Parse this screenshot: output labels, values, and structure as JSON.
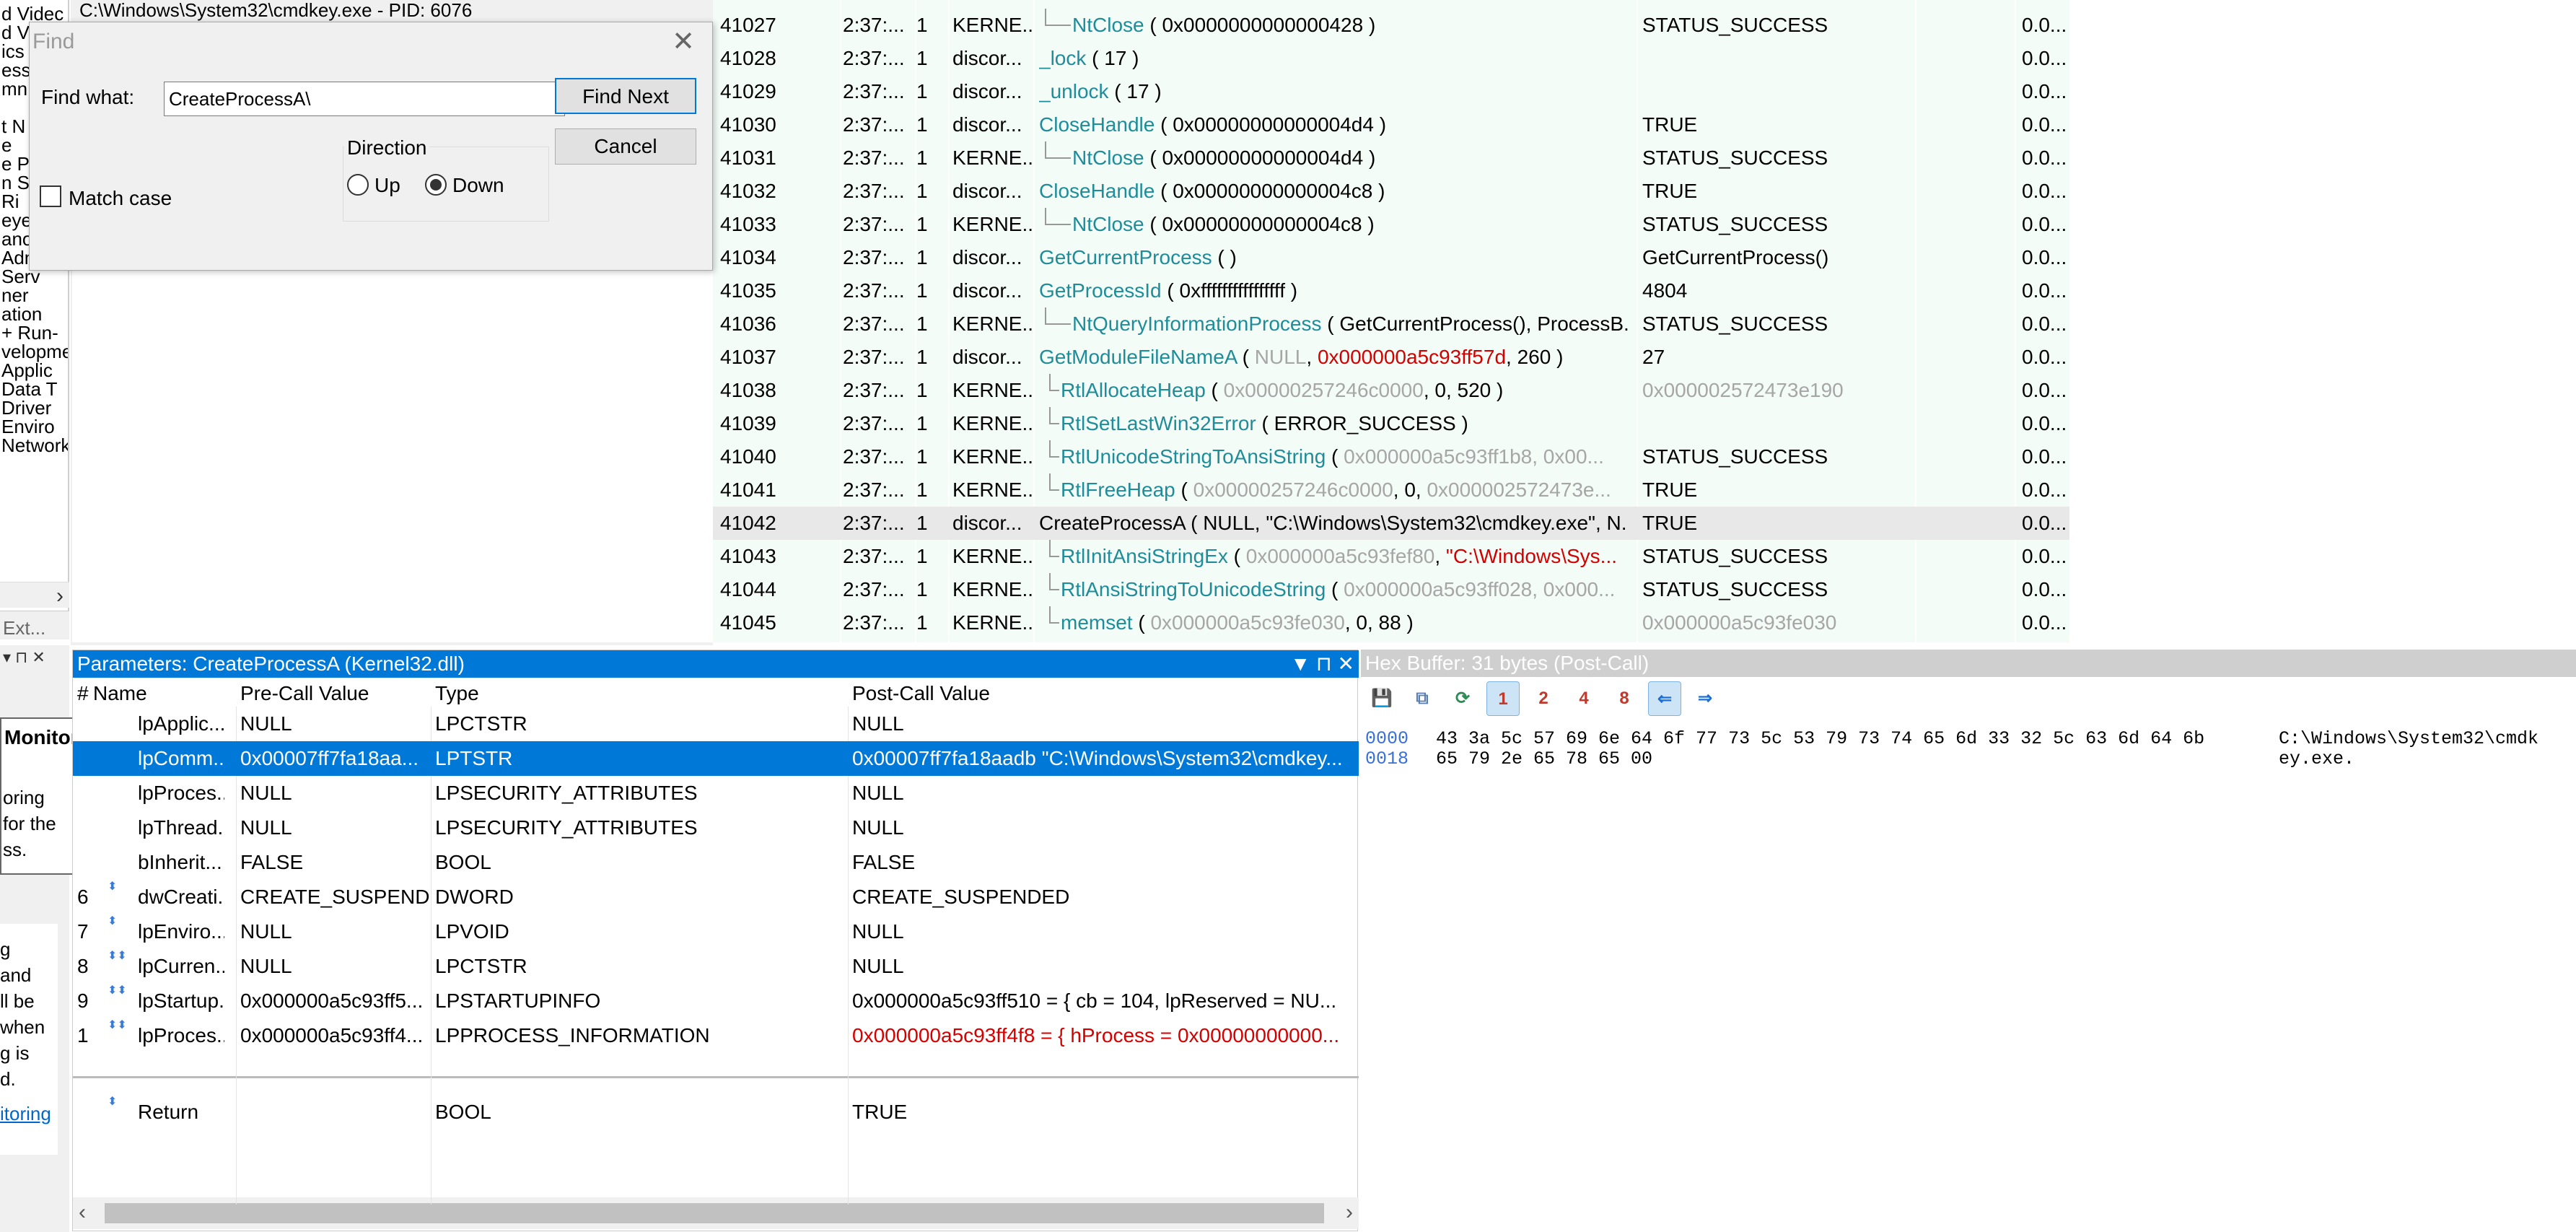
{
  "tree": {
    "lines": [
      "d Videc",
      "d Videc",
      "ics",
      "ess",
      "mn",
      "",
      "t N",
      "e",
      "e Pc",
      "n Se",
      "Ri",
      "eye",
      "ano",
      "Adm",
      "Serv",
      "ner",
      "ation",
      "+ Run-",
      "velopme",
      "Applic",
      "Data T",
      "Driver",
      "Enviro",
      "Network"
    ],
    "ext_tab": "Ext..."
  },
  "hidden_title": "C:\\Windows\\System32\\cmdkey.exe - PID: 6076",
  "find_dialog": {
    "title": "Find",
    "find_what_label": "Find what:",
    "find_what_value": "CreateProcessA\\",
    "find_next_label": "Find Next",
    "cancel_label": "Cancel",
    "direction_label": "Direction",
    "up_label": "Up",
    "down_label": "Down",
    "direction_selected": "Down",
    "match_case_label": "Match case",
    "match_case_checked": false
  },
  "trace_rows": [
    {
      "num": "41027",
      "time": "2:37:...",
      "tid": "1",
      "module": "KERNE...",
      "indent": 1,
      "fn": "NtClose",
      "args": " ( 0x0000000000000428 )",
      "ret": "STATUS_SUCCESS",
      "dur": "0.0..."
    },
    {
      "num": "41028",
      "time": "2:37:...",
      "tid": "1",
      "module": "discor...",
      "indent": 0,
      "fn": "_lock",
      "args": " ( 17 )",
      "ret": "",
      "dur": "0.0..."
    },
    {
      "num": "41029",
      "time": "2:37:...",
      "tid": "1",
      "module": "discor...",
      "indent": 0,
      "fn": "_unlock",
      "args": " ( 17 )",
      "ret": "",
      "dur": "0.0..."
    },
    {
      "num": "41030",
      "time": "2:37:...",
      "tid": "1",
      "module": "discor...",
      "indent": 0,
      "fn": "CloseHandle",
      "args": " ( 0x00000000000004d4 )",
      "ret": "TRUE",
      "dur": "0.0..."
    },
    {
      "num": "41031",
      "time": "2:37:...",
      "tid": "1",
      "module": "KERNE...",
      "indent": 1,
      "fn": "NtClose",
      "args": " ( 0x00000000000004d4 )",
      "ret": "STATUS_SUCCESS",
      "dur": "0.0..."
    },
    {
      "num": "41032",
      "time": "2:37:...",
      "tid": "1",
      "module": "discor...",
      "indent": 0,
      "fn": "CloseHandle",
      "args": " ( 0x00000000000004c8 )",
      "ret": "TRUE",
      "dur": "0.0..."
    },
    {
      "num": "41033",
      "time": "2:37:...",
      "tid": "1",
      "module": "KERNE...",
      "indent": 1,
      "fn": "NtClose",
      "args": " ( 0x00000000000004c8 )",
      "ret": "STATUS_SUCCESS",
      "dur": "0.0..."
    },
    {
      "num": "41034",
      "time": "2:37:...",
      "tid": "1",
      "module": "discor...",
      "indent": 0,
      "fn": "GetCurrentProcess",
      "args": " (  )",
      "ret": "GetCurrentProcess()",
      "dur": "0.0..."
    },
    {
      "num": "41035",
      "time": "2:37:...",
      "tid": "1",
      "module": "discor...",
      "indent": 0,
      "fn": "GetProcessId",
      "args": " ( 0xffffffffffffffff )",
      "ret": "4804",
      "dur": "0.0..."
    },
    {
      "num": "41036",
      "time": "2:37:...",
      "tid": "1",
      "module": "KERNE...",
      "indent": 1,
      "fn": "NtQueryInformationProcess",
      "args": " ( GetCurrentProcess(), ProcessB...",
      "ret": "STATUS_SUCCESS",
      "dur": "0.0..."
    },
    {
      "num": "41037",
      "time": "2:37:...",
      "tid": "1",
      "module": "discor...",
      "indent": 0,
      "fn": "GetModuleFileNameA",
      "args_parts": [
        {
          "t": " ( ",
          "c": ""
        },
        {
          "t": "NULL",
          "c": "gray"
        },
        {
          "t": ", ",
          "c": ""
        },
        {
          "t": "0x000000a5c93ff57d",
          "c": "red"
        },
        {
          "t": ", 260 )",
          "c": ""
        }
      ],
      "ret": "27",
      "dur": "0.0..."
    },
    {
      "num": "41038",
      "time": "2:37:...",
      "tid": "1",
      "module": "KERNE...",
      "indent": 2,
      "fn": "RtlAllocateHeap",
      "args_parts": [
        {
          "t": " ( ",
          "c": ""
        },
        {
          "t": "0x00000257246c0000",
          "c": "gray"
        },
        {
          "t": ", 0, 520 )",
          "c": ""
        }
      ],
      "ret": "0x000002572473e190",
      "ret_class": "gray",
      "dur": "0.0..."
    },
    {
      "num": "41039",
      "time": "2:37:...",
      "tid": "1",
      "module": "KERNE...",
      "indent": 2,
      "fn": "RtlSetLastWin32Error",
      "args": " ( ERROR_SUCCESS )",
      "ret": "",
      "dur": "0.0..."
    },
    {
      "num": "41040",
      "time": "2:37:...",
      "tid": "1",
      "module": "KERNE...",
      "indent": 2,
      "fn": "RtlUnicodeStringToAnsiString",
      "args_parts": [
        {
          "t": " ( ",
          "c": ""
        },
        {
          "t": "0x000000a5c93ff1b8, 0x00...",
          "c": "gray"
        }
      ],
      "ret": "STATUS_SUCCESS",
      "dur": "0.0..."
    },
    {
      "num": "41041",
      "time": "2:37:...",
      "tid": "1",
      "module": "KERNE...",
      "indent": 2,
      "fn": "RtlFreeHeap",
      "args_parts": [
        {
          "t": " ( ",
          "c": ""
        },
        {
          "t": "0x00000257246c0000",
          "c": "gray"
        },
        {
          "t": ", 0, ",
          "c": ""
        },
        {
          "t": "0x000002572473e...",
          "c": "gray"
        }
      ],
      "ret": "TRUE",
      "dur": "0.0..."
    },
    {
      "num": "41042",
      "time": "2:37:...",
      "tid": "1",
      "module": "discor...",
      "indent": 0,
      "fn": "CreateProcessA",
      "fn_class": "plain",
      "args": " ( NULL, \"C:\\Windows\\System32\\cmdkey.exe\", N...",
      "ret": "TRUE",
      "dur": "0.0...",
      "selected": true
    },
    {
      "num": "41043",
      "time": "2:37:...",
      "tid": "1",
      "module": "KERNE...",
      "indent": 2,
      "fn": "RtlInitAnsiStringEx",
      "args_parts": [
        {
          "t": " ( ",
          "c": ""
        },
        {
          "t": "0x000000a5c93fef80",
          "c": "gray"
        },
        {
          "t": ", ",
          "c": ""
        },
        {
          "t": "\"C:\\Windows\\Sys...",
          "c": "red"
        }
      ],
      "ret": "STATUS_SUCCESS",
      "dur": "0.0..."
    },
    {
      "num": "41044",
      "time": "2:37:...",
      "tid": "1",
      "module": "KERNE...",
      "indent": 2,
      "fn": "RtlAnsiStringToUnicodeString",
      "args_parts": [
        {
          "t": " ( ",
          "c": ""
        },
        {
          "t": "0x000000a5c93ff028, 0x000...",
          "c": "gray"
        }
      ],
      "ret": "STATUS_SUCCESS",
      "dur": "0.0..."
    },
    {
      "num": "41045",
      "time": "2:37:...",
      "tid": "1",
      "module": "KERNE...",
      "indent": 2,
      "fn": "memset",
      "args_parts": [
        {
          "t": " ( ",
          "c": ""
        },
        {
          "t": "0x000000a5c93fe030",
          "c": "gray"
        },
        {
          "t": ", 0, 88 )",
          "c": ""
        }
      ],
      "ret": "0x000000a5c93fe030",
      "ret_class": "gray",
      "dur": "0.0..."
    }
  ],
  "monitoring_tip": {
    "title": "Monitoring",
    "lines": [
      "oring",
      "for the",
      "ss."
    ]
  },
  "left_note": {
    "lines": [
      "g",
      "and",
      "ll be",
      "when",
      "g is",
      "d."
    ],
    "link": "itoring"
  },
  "params": {
    "title": "Parameters: CreateProcessA (Kernel32.dll)",
    "controls": "▼ ⊓ ✕",
    "headers": {
      "idx": "#",
      "name": "Name",
      "pre": "Pre-Call Value",
      "type": "Type",
      "post": "Post-Call Value"
    },
    "rows": [
      {
        "idx": "",
        "name": "lpApplic...",
        "pre": "NULL",
        "type": "LPCTSTR",
        "post": "NULL"
      },
      {
        "idx": "",
        "name": "lpComm...",
        "pre": "0x00007ff7fa18aa...",
        "type": "LPTSTR",
        "post": "0x00007ff7fa18aadb \"C:\\Windows\\System32\\cmdkey...",
        "selected": true
      },
      {
        "idx": "",
        "name": "lpProces...",
        "pre": "NULL",
        "type": "LPSECURITY_ATTRIBUTES",
        "post": "NULL"
      },
      {
        "idx": "",
        "name": "lpThread...",
        "pre": "NULL",
        "type": "LPSECURITY_ATTRIBUTES",
        "post": "NULL"
      },
      {
        "idx": "",
        "name": "bInherit...",
        "pre": "FALSE",
        "type": "BOOL",
        "post": "FALSE"
      },
      {
        "idx": "6",
        "name": "dwCreati...",
        "pre": "CREATE_SUSPEND...",
        "type": "DWORD",
        "post": "CREATE_SUSPENDED",
        "icon": "⬍"
      },
      {
        "idx": "7",
        "name": "lpEnviro...",
        "pre": "NULL",
        "type": "LPVOID",
        "post": "NULL",
        "icon": "⬍"
      },
      {
        "idx": "8",
        "name": "lpCurren...",
        "pre": "NULL",
        "type": "LPCTSTR",
        "post": "NULL",
        "icon": "⬍⬍"
      },
      {
        "idx": "9",
        "name": "lpStartup...",
        "pre": "0x000000a5c93ff5...",
        "type": "LPSTARTUPINFO",
        "post": "0x000000a5c93ff510 = { cb = 104, lpReserved = NU...",
        "icon": "⬍⬍"
      },
      {
        "idx": "1",
        "name": "lpProces...",
        "pre": "0x000000a5c93ff4...",
        "type": "LPPROCESS_INFORMATION",
        "post": "0x000000a5c93ff4f8 = { hProcess = 0x00000000000...",
        "post_class": "red",
        "icon": "⬍⬍"
      }
    ],
    "return_row": {
      "name": "Return",
      "type": "BOOL",
      "post": "TRUE",
      "icon": "⬍"
    }
  },
  "hex": {
    "title": "Hex Buffer: 31 bytes (Post-Call)",
    "toolbar": [
      "save",
      "copy",
      "refresh",
      "1",
      "2",
      "4",
      "8",
      "back",
      "fwd"
    ],
    "rows": [
      {
        "offset": "0000",
        "bytes": "43 3a 5c 57 69 6e 64 6f 77 73 5c 53 79 73 74 65 6d 33 32 5c 63 6d 64 6b",
        "ascii": "C:\\Windows\\System32\\cmdk"
      },
      {
        "offset": "0018",
        "bytes": "65 79 2e 65 78 65 00",
        "ascii": "ey.exe."
      }
    ]
  }
}
